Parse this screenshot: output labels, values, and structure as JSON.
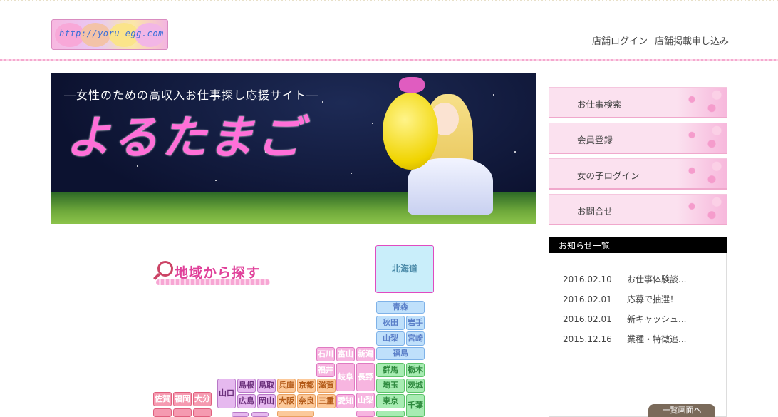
{
  "site": {
    "logo_text": "http://yoru-egg.com",
    "tagline": "―女性のための高収入お仕事探し応援サイト―",
    "title": "よるたまご"
  },
  "header": {
    "nav": [
      "店舗ログイン",
      "店舗掲載申し込み"
    ]
  },
  "sidebar": {
    "menu": [
      "お仕事検索",
      "会員登録",
      "女の子ログイン",
      "お問合せ"
    ]
  },
  "news": {
    "title": "お知らせ一覧",
    "items": [
      {
        "date": "2016.02.10",
        "text": "お仕事体験談..."
      },
      {
        "date": "2016.02.01",
        "text": "応募で抽選！"
      },
      {
        "date": "2016.02.01",
        "text": "新キャッシュ..."
      },
      {
        "date": "2015.12.16",
        "text": "業種・特徴追..."
      }
    ],
    "more_label": "一覧画面へ"
  },
  "region_search": {
    "title": "地域から探す",
    "prefs": [
      "北海道",
      "青森",
      "秋田",
      "岩手",
      "山梨",
      "宮崎",
      "福島",
      "石川",
      "富山",
      "新潟",
      "福井",
      "岐阜",
      "長野",
      "山梨",
      "群馬",
      "栃木",
      "埼玉",
      "茨城",
      "東京",
      "千葉",
      "山口",
      "島根",
      "鳥取",
      "広島",
      "岡山",
      "兵庫",
      "京都",
      "滋賀",
      "大阪",
      "奈良",
      "三重",
      "愛知",
      "佐賀",
      "福岡",
      "大分"
    ]
  },
  "colors": {
    "accent_pink": "#e0409a",
    "header_border": "#f5a9cf",
    "news_header_bg": "#000000",
    "more_button_bg": "#7a6a5a"
  }
}
